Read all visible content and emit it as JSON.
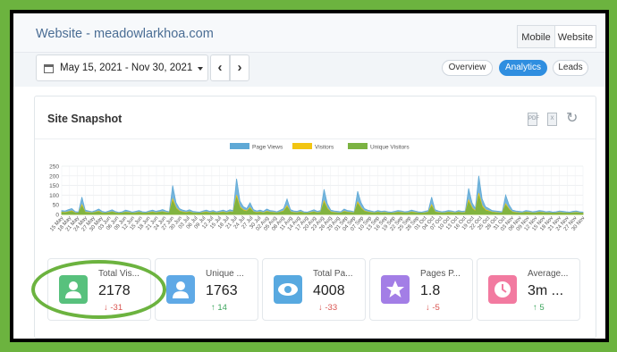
{
  "header": {
    "title": "Website - meadowlarkhoa.com",
    "device_tabs": [
      "Mobile",
      "Website"
    ]
  },
  "toolbar": {
    "date_range": "May 15, 2021 - Nov 30, 2021",
    "prev_label": "‹",
    "next_label": "›",
    "view_tabs": [
      "Overview",
      "Analytics",
      "Leads"
    ],
    "active_view": "Analytics"
  },
  "snapshot": {
    "title": "Site Snapshot",
    "icons": [
      "pdf-icon",
      "excel-icon",
      "refresh-icon"
    ],
    "stats": [
      {
        "label": "Total Vis...",
        "value": "2178",
        "change": "-31",
        "direction": "down",
        "color": "#58c17d",
        "icon": "person-icon"
      },
      {
        "label": "Unique ...",
        "value": "1763",
        "change": "14",
        "direction": "up",
        "color": "#5fa9e6",
        "icon": "person-icon"
      },
      {
        "label": "Total Pa...",
        "value": "4008",
        "change": "-33",
        "direction": "down",
        "color": "#58a9e0",
        "icon": "eye-icon"
      },
      {
        "label": "Pages P...",
        "value": "1.8",
        "change": "-5",
        "direction": "down",
        "color": "#a37ee6",
        "icon": "star-icon"
      },
      {
        "label": "Average...",
        "value": "3m ...",
        "change": "5",
        "direction": "up",
        "color": "#f27aa0",
        "icon": "clock-icon"
      }
    ]
  },
  "chart_data": {
    "type": "area",
    "title": "",
    "xlabel": "",
    "ylabel": "",
    "ylim": [
      0,
      250
    ],
    "yticks": [
      0,
      50,
      100,
      150,
      200,
      250
    ],
    "grid": true,
    "legend_position": "top",
    "x_tick_labels": [
      "15 May",
      "18 May",
      "21 May",
      "24 May",
      "27 May",
      "30 May",
      "03 Jun",
      "06 Jun",
      "09 Jun",
      "12 Jun",
      "15 Jun",
      "18 Jun",
      "21 Jun",
      "24 Jun",
      "27 Jun",
      "30 Jun",
      "03 Jul",
      "06 Jul",
      "09 Jul",
      "12 Jul",
      "15 Jul",
      "18 Jul",
      "21 Jul",
      "24 Jul",
      "27 Jul",
      "30 Jul",
      "02 Aug",
      "05 Aug",
      "08 Aug",
      "11 Aug",
      "14 Aug",
      "17 Aug",
      "20 Aug",
      "23 Aug",
      "26 Aug",
      "29 Aug",
      "01 Sep",
      "04 Sep",
      "07 Sep",
      "10 Sep",
      "13 Sep",
      "16 Sep",
      "19 Sep",
      "22 Sep",
      "25 Sep",
      "28 Sep",
      "01 Oct",
      "04 Oct",
      "07 Oct",
      "10 Oct",
      "13 Oct",
      "16 Oct",
      "19 Oct",
      "22 Oct",
      "25 Oct",
      "28 Oct",
      "31 Oct",
      "03 Nov",
      "06 Nov",
      "09 Nov",
      "12 Nov",
      "15 Nov",
      "18 Nov",
      "21 Nov",
      "24 Nov",
      "27 Nov",
      "30 Nov"
    ],
    "series": [
      {
        "name": "Page Views",
        "color": "#5fa9d6",
        "values": [
          20,
          18,
          25,
          30,
          15,
          12,
          90,
          22,
          18,
          14,
          20,
          28,
          16,
          12,
          18,
          24,
          15,
          10,
          14,
          22,
          18,
          12,
          16,
          20,
          14,
          12,
          18,
          22,
          16,
          20,
          25,
          18,
          14,
          150,
          60,
          30,
          22,
          18,
          24,
          16,
          14,
          12,
          18,
          22,
          16,
          20,
          14,
          18,
          22,
          16,
          24,
          20,
          185,
          70,
          40,
          30,
          60,
          25,
          18,
          22,
          16,
          28,
          20,
          18,
          14,
          22,
          30,
          80,
          25,
          18,
          16,
          22,
          14,
          12,
          18,
          24,
          16,
          20,
          130,
          55,
          22,
          18,
          16,
          14,
          28,
          20,
          18,
          14,
          120,
          60,
          30,
          22,
          18,
          14,
          20,
          16,
          18,
          14,
          12,
          16,
          20,
          18,
          14,
          16,
          22,
          18,
          14,
          12,
          16,
          20,
          90,
          24,
          18,
          14,
          16,
          20,
          18,
          14,
          20,
          16,
          18,
          135,
          60,
          30,
          200,
          80,
          40,
          30,
          20,
          18,
          16,
          14,
          100,
          50,
          22,
          18,
          16,
          14,
          20,
          18,
          14,
          16,
          20,
          18,
          14,
          16,
          12,
          14,
          18,
          16,
          14,
          12,
          16,
          18,
          14,
          12
        ]
      },
      {
        "name": "Visitors",
        "color": "#f2c511",
        "values": [
          12,
          10,
          14,
          18,
          9,
          7,
          50,
          12,
          10,
          8,
          12,
          16,
          9,
          7,
          10,
          14,
          9,
          6,
          8,
          12,
          10,
          7,
          9,
          12,
          8,
          7,
          10,
          13,
          9,
          12,
          14,
          10,
          8,
          80,
          35,
          18,
          13,
          10,
          14,
          9,
          8,
          7,
          10,
          13,
          9,
          12,
          8,
          10,
          13,
          9,
          14,
          12,
          100,
          40,
          24,
          18,
          35,
          14,
          10,
          13,
          9,
          16,
          12,
          10,
          8,
          13,
          18,
          45,
          14,
          10,
          9,
          13,
          8,
          7,
          10,
          14,
          9,
          12,
          70,
          32,
          13,
          10,
          9,
          8,
          16,
          12,
          10,
          8,
          65,
          35,
          18,
          13,
          10,
          8,
          12,
          9,
          10,
          8,
          7,
          9,
          12,
          10,
          8,
          9,
          13,
          10,
          8,
          7,
          9,
          12,
          50,
          14,
          10,
          8,
          9,
          12,
          10,
          8,
          12,
          9,
          10,
          75,
          35,
          18,
          110,
          45,
          24,
          18,
          12,
          10,
          9,
          8,
          55,
          28,
          13,
          10,
          9,
          8,
          12,
          10,
          8,
          9,
          12,
          10,
          8,
          9,
          7,
          8,
          10,
          9,
          8,
          7,
          9,
          10,
          8,
          7
        ]
      },
      {
        "name": "Unique Visitors",
        "color": "#7cb342",
        "values": [
          10,
          8,
          12,
          15,
          7,
          6,
          42,
          10,
          8,
          7,
          10,
          13,
          7,
          6,
          8,
          12,
          7,
          5,
          7,
          10,
          8,
          6,
          7,
          10,
          7,
          6,
          8,
          11,
          7,
          10,
          12,
          8,
          7,
          68,
          30,
          15,
          11,
          8,
          12,
          7,
          7,
          6,
          8,
          11,
          7,
          10,
          7,
          8,
          11,
          7,
          12,
          10,
          85,
          34,
          20,
          15,
          30,
          12,
          8,
          11,
          7,
          13,
          10,
          8,
          7,
          11,
          15,
          38,
          12,
          8,
          7,
          11,
          7,
          6,
          8,
          12,
          7,
          10,
          60,
          27,
          11,
          8,
          7,
          7,
          13,
          10,
          8,
          7,
          55,
          30,
          15,
          11,
          8,
          7,
          10,
          7,
          8,
          7,
          6,
          7,
          10,
          8,
          7,
          7,
          11,
          8,
          7,
          6,
          7,
          10,
          42,
          12,
          8,
          7,
          7,
          10,
          8,
          7,
          10,
          7,
          8,
          64,
          30,
          15,
          94,
          38,
          20,
          15,
          10,
          8,
          7,
          7,
          47,
          24,
          11,
          8,
          7,
          7,
          10,
          8,
          7,
          7,
          10,
          8,
          7,
          7,
          6,
          7,
          8,
          7,
          7,
          6,
          7,
          8,
          7,
          6
        ]
      }
    ]
  }
}
